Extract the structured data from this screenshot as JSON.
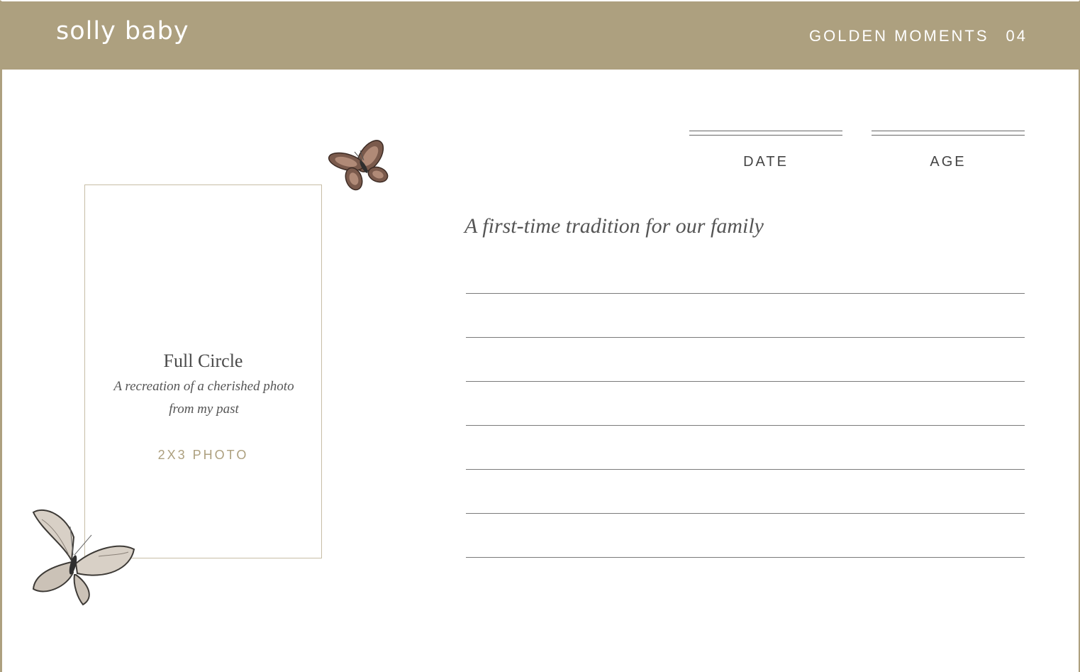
{
  "header": {
    "logo": "solly baby",
    "section_title": "GOLDEN MOMENTS",
    "page_number": "04"
  },
  "photo_card": {
    "title": "Full Circle",
    "description_line1": "A recreation of  a cherished photo",
    "description_line2": "from my past",
    "size_label": "2X3 PHOTO"
  },
  "fields": {
    "date_label": "DATE",
    "age_label": "AGE"
  },
  "prompt": "A first-time tradition for our family",
  "writing_lines_count": 7,
  "colors": {
    "brand_tan": "#ada07f",
    "text_dark": "#4a4a4a",
    "line_gray": "#7a7a7a"
  },
  "icons": [
    "butterfly-small-icon",
    "butterfly-large-icon"
  ]
}
